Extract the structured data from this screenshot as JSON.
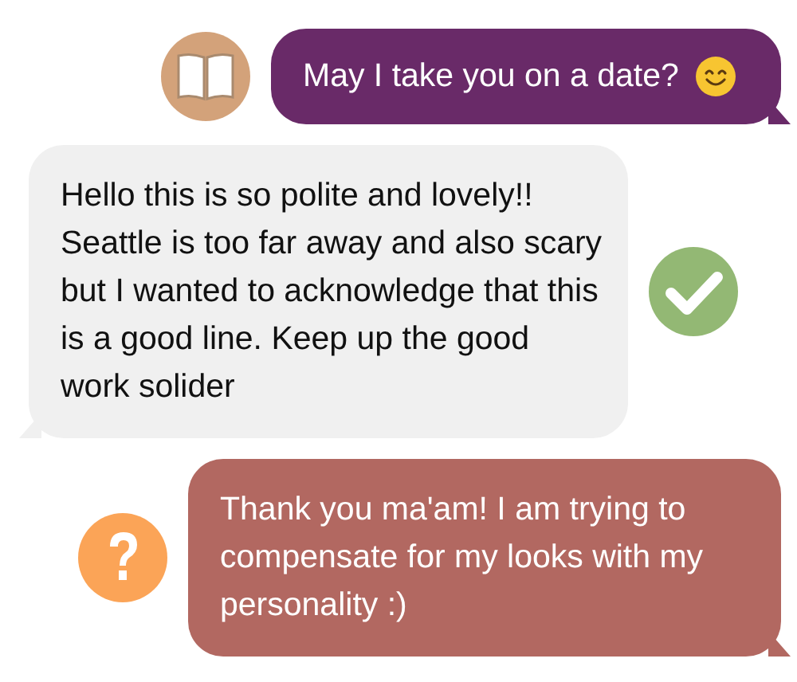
{
  "messages": [
    {
      "kind": "outgoing",
      "color": "#692a68",
      "badge": {
        "kind": "book"
      },
      "text": "May I take you on a date?",
      "trailing_icon": {
        "kind": "smile"
      }
    },
    {
      "kind": "incoming",
      "color": "#f0f0f0",
      "badge": {
        "kind": "check"
      },
      "text": "Hello this is so polite and lovely!! Seattle is too far away and also scary but I wanted to acknowledge that this is a good line. Keep up the good work solider"
    },
    {
      "kind": "outgoing",
      "color": "#b26861",
      "badge": {
        "kind": "question"
      },
      "text": "Thank you ma'am! I am trying to compensate for my looks with my personality :)"
    }
  ]
}
